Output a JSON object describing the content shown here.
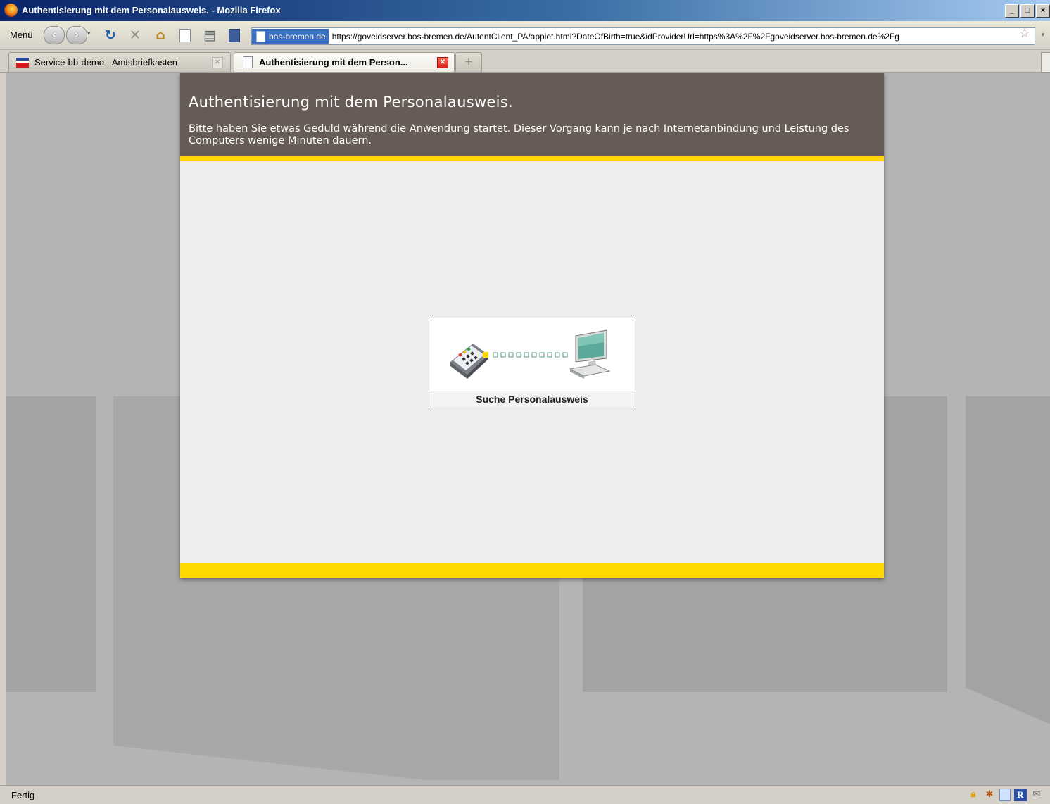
{
  "window": {
    "title": "Authentisierung mit dem Personalausweis. - Mozilla Firefox",
    "controls": {
      "minimize": "_",
      "maximize": "□",
      "close": "×"
    }
  },
  "toolbar": {
    "menu_label": "Menü",
    "back_label": "‹",
    "forward_label": "›",
    "dropdown": "▾",
    "reload_icon": "reload-icon",
    "stop_icon": "stop-icon",
    "home_icon": "home-icon",
    "print_icon": "print-icon",
    "bookmarks_icon": "bookmarks-icon"
  },
  "address": {
    "site_identity": "bos-bremen.de",
    "url": "https://goveidserver.bos-bremen.de/AutentClient_PA/applet.html?DateOfBirth=true&idProviderUrl=https%3A%2F%2Fgoveidserver.bos-bremen.de%2Fg",
    "star": "☆"
  },
  "tabs": [
    {
      "label": "Service-bb-demo - Amtsbriefkasten",
      "active": false
    },
    {
      "label": "Authentisierung mit dem Person...",
      "active": true
    }
  ],
  "new_tab_label": "+",
  "page": {
    "title": "Authentisierung mit dem Personalausweis.",
    "description": "Bitte haben Sie etwas Geduld während die Anwendung startet. Dieser Vorgang kann je nach Internetanbindung und Leistung des Computers wenige Minuten dauern.",
    "status_label": "Suche Personalausweis"
  },
  "colors": {
    "header_bg": "#665b55",
    "accent_yellow": "#ffd800",
    "panel_bg": "#ededed"
  },
  "statusbar": {
    "text": "Fertig",
    "icons": [
      "lock-icon",
      "cookie-icon",
      "page-icon",
      "r-icon",
      "mail-icon"
    ]
  }
}
